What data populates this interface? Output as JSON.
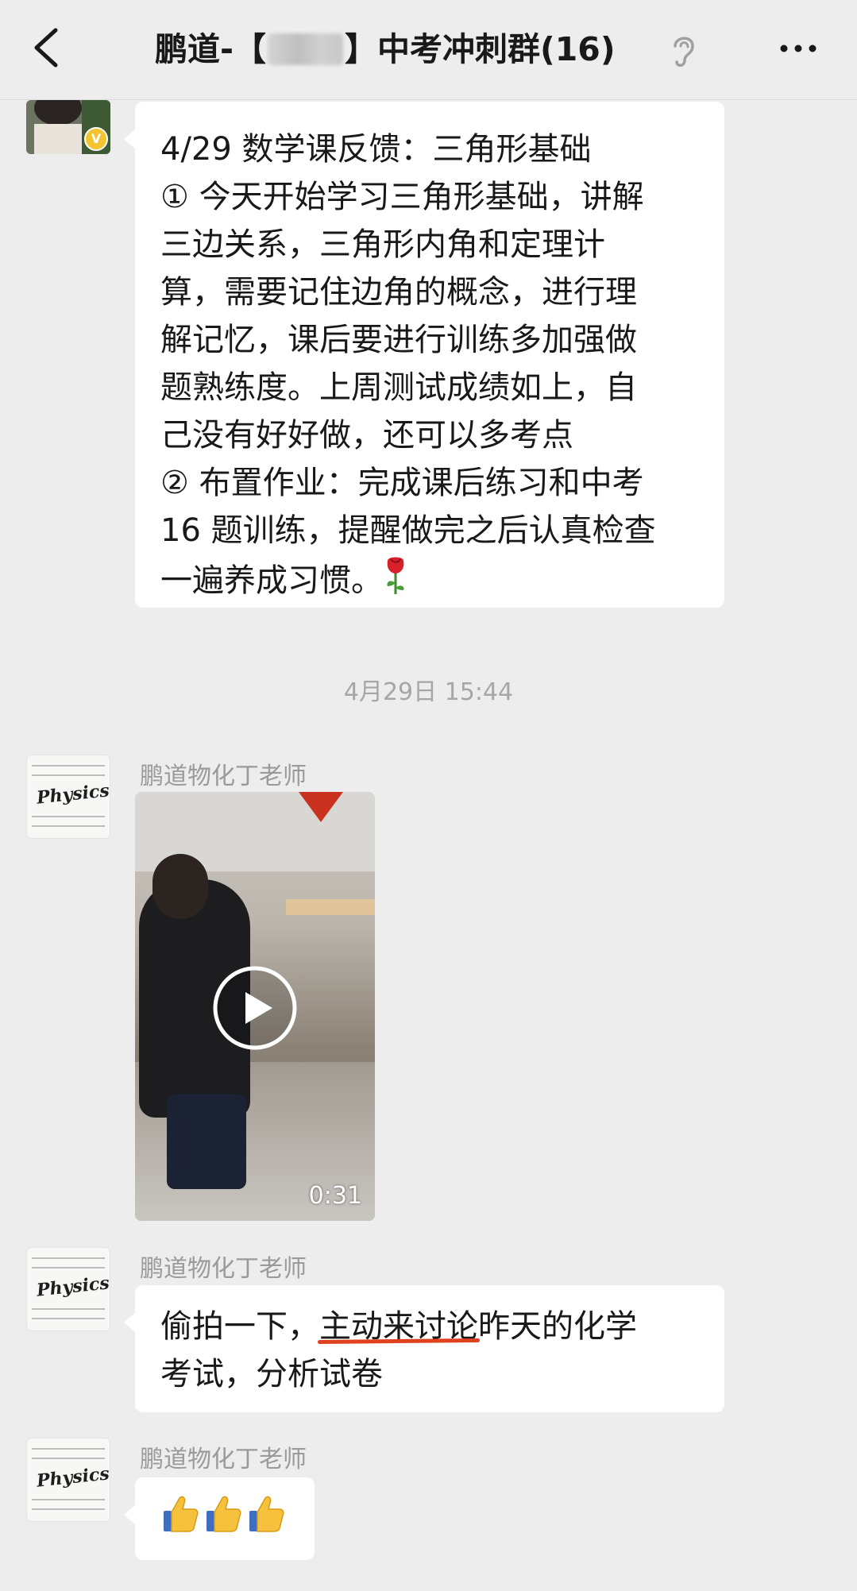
{
  "header": {
    "title_prefix": "鹏道-【",
    "title_censored_char": "李",
    "title_suffix": "】中考冲刺群(16)",
    "back_icon": "chevron-left-icon",
    "ear_icon": "ear-icon",
    "more_icon": "more-icon"
  },
  "messages": {
    "m1": {
      "lines": [
        "4/29 数学课反馈：三角形基础",
        "① 今天开始学习三角形基础，讲解",
        "三边关系，三角形内角和定理计",
        "算，需要记住边角的概念，进行理",
        "解记忆，课后要进行训练多加强做",
        "题熟练度。上周测试成绩如上，自",
        "己没有好好做，还可以多考点",
        "② 布置作业：完成课后练习和中考",
        "16 题训练，提醒做完之后认真检查",
        "一遍养成习惯。"
      ],
      "emoji": "rose-icon"
    },
    "timestamp": "4月29日 15:44",
    "m2": {
      "sender": "鹏道物化丁老师",
      "duration": "0:31"
    },
    "m3": {
      "sender": "鹏道物化丁老师",
      "line1_a": "偷拍一下，",
      "line1_b": "主动来讨论",
      "line1_c": "昨天的化学",
      "line2": "考试，分析试卷"
    },
    "m4": {
      "sender": "鹏道物化丁老师",
      "emoji": "thumbs-up-icon",
      "count": 3
    }
  },
  "avatar_text": "Physics",
  "colors": {
    "background": "#ededed",
    "bubble": "#ffffff",
    "underline": "#e0421f"
  }
}
